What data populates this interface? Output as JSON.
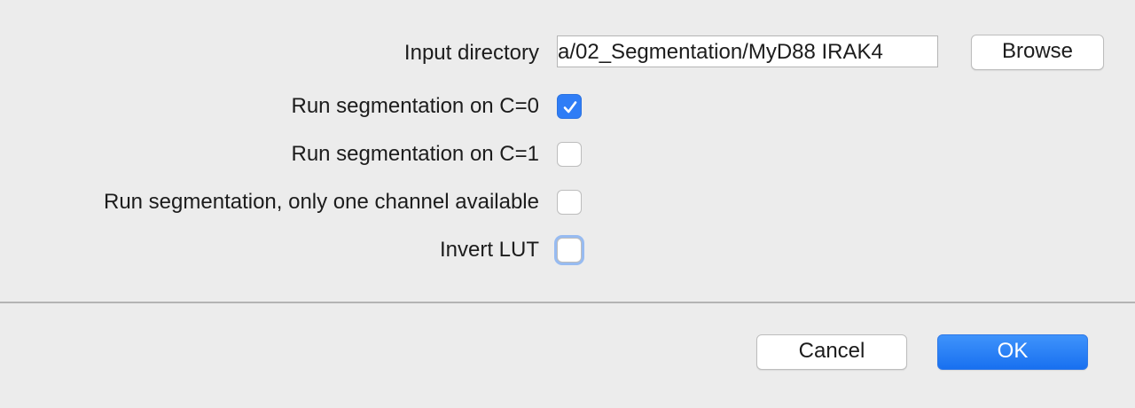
{
  "dialog": {
    "fields": {
      "input_directory": {
        "label": "Input directory",
        "value": "a/02_Segmentation/MyD88 IRAK4",
        "browse_label": "Browse"
      }
    },
    "checkboxes": [
      {
        "label": "Run segmentation on C=0",
        "checked": true
      },
      {
        "label": "Run segmentation on C=1",
        "checked": false
      },
      {
        "label": "Run segmentation, only one channel available",
        "checked": false
      },
      {
        "label": "Invert LUT",
        "checked": false,
        "focused": true
      }
    ],
    "buttons": {
      "cancel_label": "Cancel",
      "ok_label": "OK"
    },
    "colors": {
      "background": "#ececec",
      "accent": "#2f7df6"
    },
    "icons": {
      "checkmark": "checkmark-icon"
    }
  }
}
